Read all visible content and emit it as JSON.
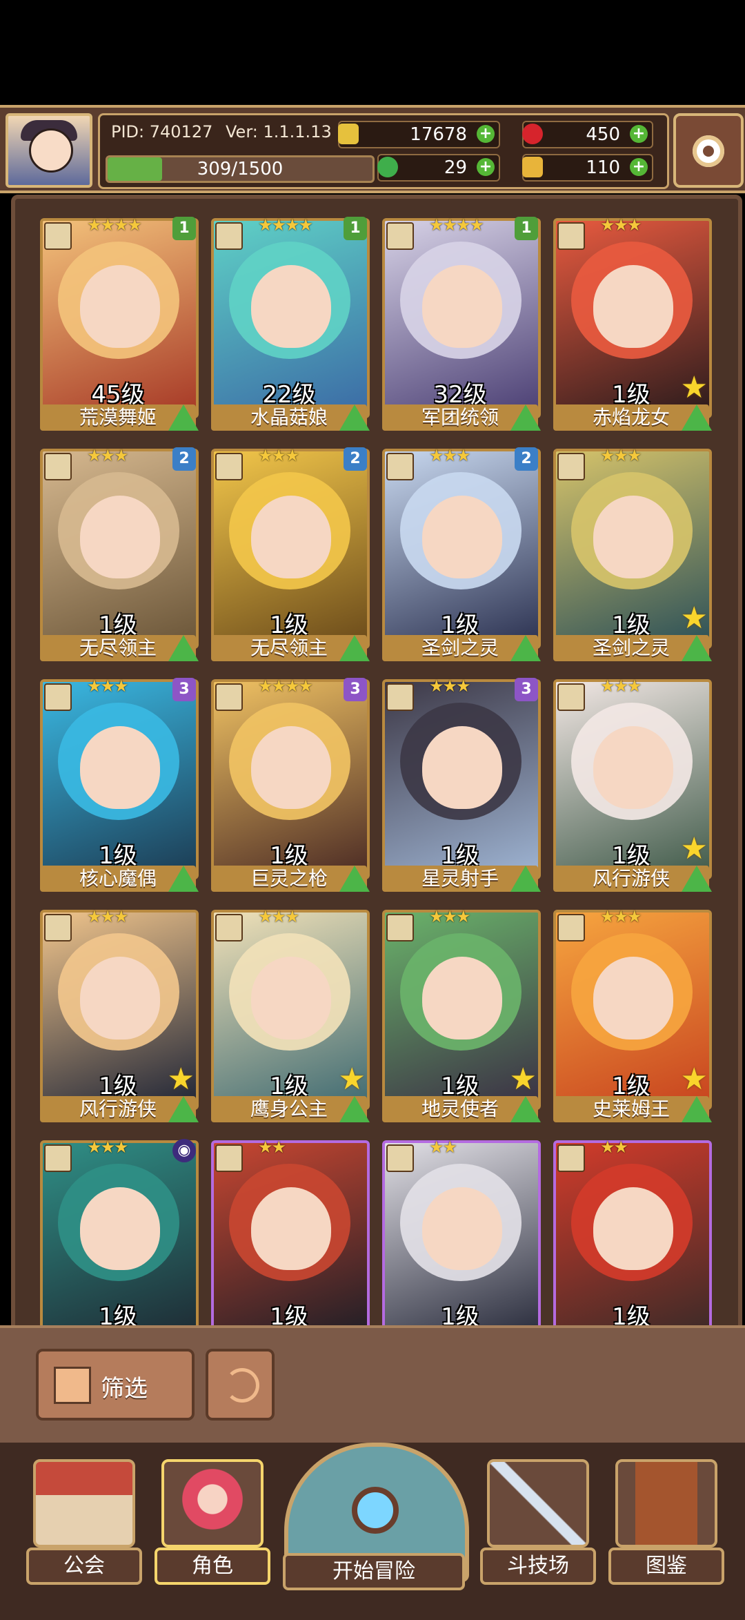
{
  "header": {
    "pid": "PID: 740127",
    "version": "Ver: 1.1.1.13",
    "xp": "309/1500",
    "xp_fraction": 0.206,
    "gold": "17678",
    "gems": "450",
    "clover": "29",
    "keys": "110"
  },
  "roster": [
    {
      "name": "荒漠舞姬",
      "level": "45级",
      "stars": "★★★★",
      "badge": "1",
      "badge_color": "green",
      "theme": [
        "#f3c27b",
        "#a63826"
      ]
    },
    {
      "name": "水晶菇娘",
      "level": "22级",
      "stars": "★★★★",
      "badge": "1",
      "badge_color": "green",
      "theme": [
        "#5fd1c6",
        "#3b6aa5"
      ]
    },
    {
      "name": "军团统领",
      "level": "32级",
      "stars": "★★★★",
      "badge": "1",
      "badge_color": "green",
      "theme": [
        "#d7d2e6",
        "#4a3e73"
      ]
    },
    {
      "name": "赤焰龙女",
      "level": "1级",
      "stars": "★★★",
      "badge": "",
      "badge_color": "",
      "theme": [
        "#e85a3f",
        "#2a1b1c"
      ]
    },
    {
      "name": "无尽领主",
      "level": "1级",
      "stars": "★★★",
      "badge": "2",
      "badge_color": "blue",
      "theme": [
        "#d6b88f",
        "#6a5538"
      ]
    },
    {
      "name": "无尽领主",
      "level": "1级",
      "stars": "★★★",
      "badge": "2",
      "badge_color": "blue",
      "theme": [
        "#f2c64a",
        "#6a4a1a"
      ]
    },
    {
      "name": "圣剑之灵",
      "level": "1级",
      "stars": "★★★",
      "badge": "2",
      "badge_color": "blue",
      "theme": [
        "#c8d8ef",
        "#2b3150"
      ]
    },
    {
      "name": "圣剑之灵",
      "level": "1级",
      "stars": "★★★",
      "badge": "",
      "badge_color": "",
      "theme": [
        "#d6c36a",
        "#2b5058"
      ]
    },
    {
      "name": "核心魔偶",
      "level": "1级",
      "stars": "★★★",
      "badge": "3",
      "badge_color": "purple",
      "theme": [
        "#3ab8e2",
        "#1c3b52"
      ]
    },
    {
      "name": "巨灵之枪",
      "level": "1级",
      "stars": "★★★★",
      "badge": "3",
      "badge_color": "purple",
      "theme": [
        "#f0c263",
        "#4a2a24"
      ]
    },
    {
      "name": "星灵射手",
      "level": "1级",
      "stars": "★★★",
      "badge": "3",
      "badge_color": "purple",
      "theme": [
        "#3d3846",
        "#9fb5d4"
      ]
    },
    {
      "name": "风行游侠",
      "level": "1级",
      "stars": "★★★",
      "badge": "",
      "badge_color": "",
      "theme": [
        "#f2e7e4",
        "#3f5a49"
      ]
    },
    {
      "name": "风行游侠",
      "level": "1级",
      "stars": "★★★",
      "badge": "",
      "badge_color": "",
      "theme": [
        "#f1c58c",
        "#1e2436"
      ]
    },
    {
      "name": "鹰身公主",
      "level": "1级",
      "stars": "★★★",
      "badge": "",
      "badge_color": "",
      "theme": [
        "#f1e1b8",
        "#3e6a72"
      ]
    },
    {
      "name": "地灵使者",
      "level": "1级",
      "stars": "★★★",
      "badge": "",
      "badge_color": "",
      "theme": [
        "#6ab36a",
        "#3a2f44"
      ]
    },
    {
      "name": "史莱姆王",
      "level": "1级",
      "stars": "★★★",
      "badge": "",
      "badge_color": "",
      "theme": [
        "#f6a53f",
        "#c7431f"
      ]
    },
    {
      "name": "",
      "level": "1级",
      "stars": "★★★",
      "badge": "◉",
      "badge_color": "orb",
      "theme": [
        "#2f8f86",
        "#1e2a33"
      ]
    },
    {
      "name": "",
      "level": "1级",
      "stars": "★★",
      "badge": "",
      "badge_color": "",
      "theme": [
        "#c84631",
        "#1e1e26"
      ],
      "purple": true
    },
    {
      "name": "",
      "level": "1级",
      "stars": "★★",
      "badge": "",
      "badge_color": "",
      "theme": [
        "#e2e0e6",
        "#272a3a"
      ],
      "purple": true
    },
    {
      "name": "",
      "level": "1级",
      "stars": "★★",
      "badge": "",
      "badge_color": "",
      "theme": [
        "#d23b2a",
        "#3a2a28"
      ],
      "purple": true
    }
  ],
  "controls": {
    "filter_label": "筛选"
  },
  "nav": {
    "guild": "公会",
    "characters": "角色",
    "adventure": "开始冒险",
    "arena": "斗技场",
    "codex": "图鉴"
  }
}
